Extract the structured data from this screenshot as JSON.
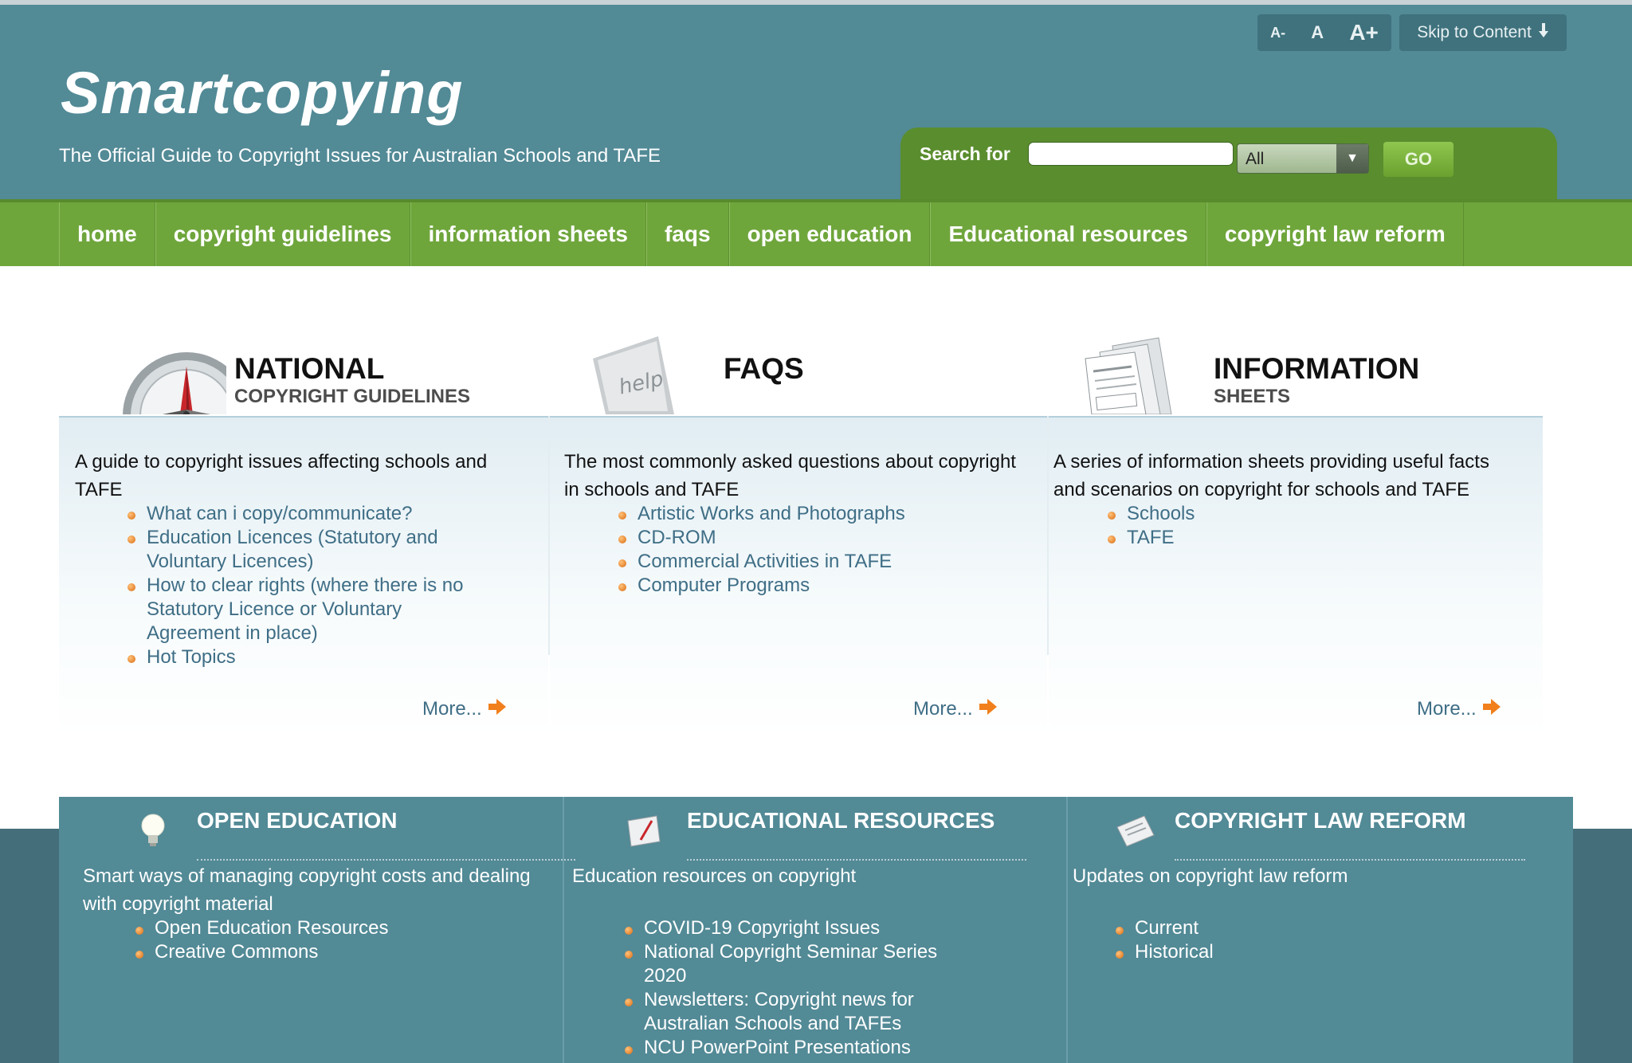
{
  "site": {
    "title": "Smartcopying",
    "tagline": "The Official Guide to Copyright Issues for Australian Schools and TAFE"
  },
  "toolbar": {
    "font_small": "A-",
    "font_normal": "A",
    "font_large": "A+",
    "skip_label": "Skip to Content"
  },
  "search": {
    "label": "Search for",
    "value": "",
    "scope_selected": "All",
    "go_label": "GO"
  },
  "nav": {
    "items": [
      "home",
      "copyright guidelines",
      "information sheets",
      "faqs",
      "open education",
      "Educational resources",
      "copyright law reform"
    ]
  },
  "columns": [
    {
      "title": "NATIONAL",
      "subtitle": "COPYRIGHT GUIDELINES",
      "icon": "compass-icon",
      "description": "A guide to copyright issues affecting schools and TAFE",
      "links": [
        "What can i copy/communicate?",
        "Education Licences (Statutory and Voluntary Licences)",
        "How to clear rights (where there is no Statutory Licence or Voluntary Agreement in place)",
        "Hot Topics"
      ],
      "more": "More..."
    },
    {
      "title": "FAQS",
      "subtitle": "",
      "icon": "help-key-icon",
      "icon_text": "help",
      "description": "The most commonly asked questions about copyright in schools and TAFE",
      "links": [
        "Artistic Works and Photographs",
        "CD-ROM",
        "Commercial Activities in TAFE",
        "Computer Programs"
      ],
      "more": "More..."
    },
    {
      "title": "INFORMATION",
      "subtitle": "SHEETS",
      "icon": "documents-icon",
      "description": "A series of information sheets providing useful facts and scenarios on copyright for schools and TAFE",
      "links": [
        "Schools",
        "TAFE"
      ],
      "more": "More..."
    }
  ],
  "footer_columns": [
    {
      "title": "OPEN EDUCATION",
      "icon": "lightbulb-icon",
      "description": "Smart ways of managing copyright costs and dealing with copyright material",
      "links": [
        "Open Education Resources",
        "Creative Commons"
      ]
    },
    {
      "title": "EDUCATIONAL RESOURCES",
      "icon": "book-pencil-icon",
      "description": "Education resources on copyright",
      "links": [
        "COVID-19 Copyright Issues",
        "National Copyright Seminar Series 2020",
        "Newsletters: Copyright news for Australian Schools and TAFEs",
        "NCU PowerPoint Presentations"
      ]
    },
    {
      "title": "COPYRIGHT LAW REFORM",
      "icon": "newspaper-icon",
      "description": "Updates on copyright law reform",
      "links": [
        "Current",
        "Historical"
      ]
    }
  ],
  "colors": {
    "header_teal": "#528a96",
    "nav_green": "#6fa63c",
    "search_green": "#5a8d2e",
    "link_blue": "#3f6e86",
    "bullet_orange": "#d96a10"
  }
}
